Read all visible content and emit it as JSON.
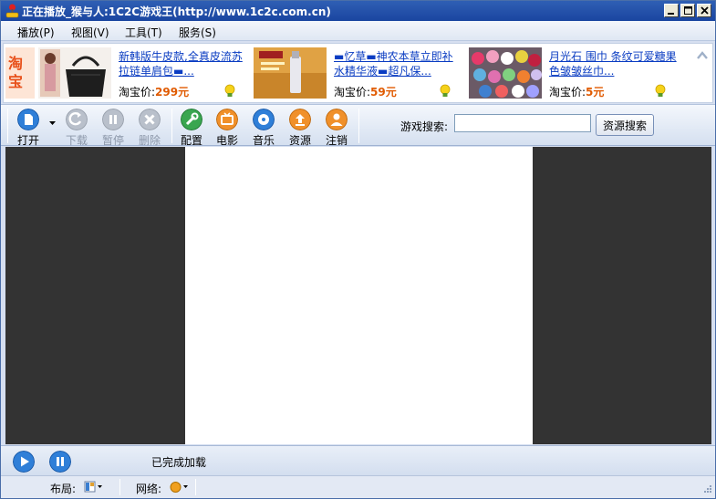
{
  "window": {
    "title": "正在播放_猴与人:1C2C游戏王(http://www.1c2c.com.cn)",
    "controls": [
      "minimize-icon",
      "maximize-icon",
      "close-icon"
    ]
  },
  "menu": {
    "items": [
      "播放(P)",
      "视图(V)",
      "工具(T)",
      "服务(S)"
    ]
  },
  "ads": {
    "side_logo": "淘宝",
    "items": [
      {
        "title": "新韩版牛皮款,全真皮流苏拉链单肩包▬...",
        "price_label": "淘宝价:",
        "price": "299元"
      },
      {
        "title": "▬忆草▬神农本草立即补水精华液▬超凡保...",
        "price_label": "淘宝价:",
        "price": "59元"
      },
      {
        "title": "月光石 围巾 条纹可爱糖果色皱皱丝巾...",
        "price_label": "淘宝价:",
        "price": "5元"
      }
    ]
  },
  "toolbar": {
    "buttons": [
      {
        "label": "打开",
        "icon": "open-file-icon",
        "enabled": true
      },
      {
        "label": "下载",
        "icon": "download-arrow-icon",
        "enabled": false
      },
      {
        "label": "暂停",
        "icon": "pause-icon",
        "enabled": false
      },
      {
        "label": "删除",
        "icon": "delete-x-icon",
        "enabled": false
      },
      {
        "label": "配置",
        "icon": "wrench-icon",
        "enabled": true
      },
      {
        "label": "电影",
        "icon": "tv-icon",
        "enabled": true
      },
      {
        "label": "音乐",
        "icon": "music-disc-icon",
        "enabled": true
      },
      {
        "label": "资源",
        "icon": "upload-resource-icon",
        "enabled": true
      },
      {
        "label": "注销",
        "icon": "user-logout-icon",
        "enabled": true
      }
    ],
    "search_label": "游戏搜索:",
    "search_value": "",
    "search_button": "资源搜索"
  },
  "player": {
    "status": "已完成加载"
  },
  "statusbar": {
    "layout_label": "布局:",
    "network_label": "网络:"
  },
  "colors": {
    "titlebar": "#1a45a0",
    "content_bg": "#333333",
    "price": "#e05a00",
    "link": "#0a3cc2"
  }
}
